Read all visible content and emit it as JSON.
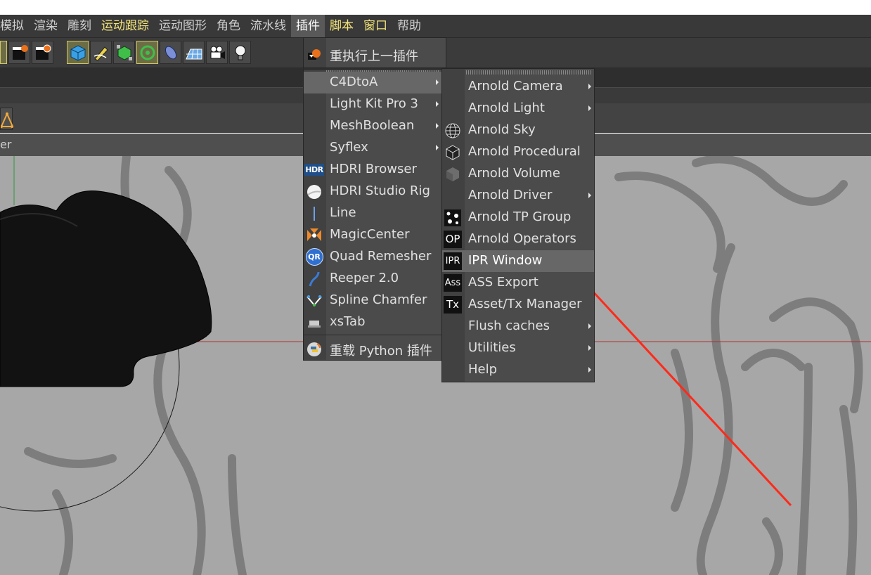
{
  "menubar": {
    "items": [
      {
        "label": "模拟",
        "style": "normal"
      },
      {
        "label": "渲染",
        "style": "normal"
      },
      {
        "label": "雕刻",
        "style": "normal"
      },
      {
        "label": "运动跟踪",
        "style": "yellow"
      },
      {
        "label": "运动图形",
        "style": "normal"
      },
      {
        "label": "角色",
        "style": "normal"
      },
      {
        "label": "流水线",
        "style": "normal"
      },
      {
        "label": "插件",
        "style": "active"
      },
      {
        "label": "脚本",
        "style": "yellow"
      },
      {
        "label": "窗口",
        "style": "yellow"
      },
      {
        "label": "帮助",
        "style": "normal"
      }
    ]
  },
  "viewport": {
    "header_text": "er"
  },
  "plugins_menu": {
    "top_item": "重执行上一插件",
    "items": [
      {
        "label": "C4DtoA",
        "submenu": true,
        "icon": "none"
      },
      {
        "label": "Light Kit Pro 3",
        "submenu": true,
        "icon": "none"
      },
      {
        "label": "MeshBoolean",
        "submenu": true,
        "icon": "none"
      },
      {
        "label": "Syflex",
        "submenu": true,
        "icon": "none"
      },
      {
        "label": "HDRI Browser",
        "submenu": false,
        "icon": "hdr-icon",
        "icon_text": "HDR"
      },
      {
        "label": "HDRI Studio Rig",
        "submenu": false,
        "icon": "sphere-icon"
      },
      {
        "label": "Line",
        "submenu": false,
        "icon": "line-icon"
      },
      {
        "label": "MagicCenter",
        "submenu": false,
        "icon": "magic-center-icon"
      },
      {
        "label": "Quad Remesher",
        "submenu": false,
        "icon": "qr-icon",
        "icon_text": "QR"
      },
      {
        "label": "Reeper 2.0",
        "submenu": false,
        "icon": "rope-icon"
      },
      {
        "label": "Spline Chamfer",
        "submenu": false,
        "icon": "chamfer-icon"
      },
      {
        "label": "xsTab",
        "submenu": false,
        "icon": "tab-icon"
      }
    ],
    "bottom_item": "重载 Python 插件"
  },
  "c4dtoa_menu": {
    "items": [
      {
        "label": "Arnold Camera",
        "submenu": true,
        "icon": "none"
      },
      {
        "label": "Arnold Light",
        "submenu": true,
        "icon": "none"
      },
      {
        "label": "Arnold Sky",
        "submenu": false,
        "icon": "globe-icon"
      },
      {
        "label": "Arnold Procedural",
        "submenu": false,
        "icon": "cube-wire-icon"
      },
      {
        "label": "Arnold Volume",
        "submenu": false,
        "icon": "volume-cube-icon"
      },
      {
        "label": "Arnold Driver",
        "submenu": true,
        "icon": "none"
      },
      {
        "label": "Arnold TP Group",
        "submenu": false,
        "icon": "particles-icon"
      },
      {
        "label": "Arnold Operators",
        "submenu": false,
        "icon": "op-icon",
        "icon_text": "OP"
      },
      {
        "label": "IPR Window",
        "submenu": false,
        "icon": "ipr-icon",
        "icon_text": "IPR"
      },
      {
        "label": "ASS Export",
        "submenu": false,
        "icon": "ass-icon",
        "icon_text": "Ass"
      },
      {
        "label": "Asset/Tx Manager",
        "submenu": false,
        "icon": "tx-icon",
        "icon_text": "Tx"
      },
      {
        "label": "Flush caches",
        "submenu": true,
        "icon": "none"
      },
      {
        "label": "Utilities",
        "submenu": true,
        "icon": "none"
      },
      {
        "label": "Help",
        "submenu": true,
        "icon": "none"
      }
    ]
  },
  "colors": {
    "menubar_bg": "#393939",
    "menu_bg": "#4b4b4b",
    "highlight": "#676767",
    "yellow_text": "#f2e37a",
    "annotation_arrow": "#ff2a1a",
    "viewport_bg": "#a7a7a7"
  }
}
